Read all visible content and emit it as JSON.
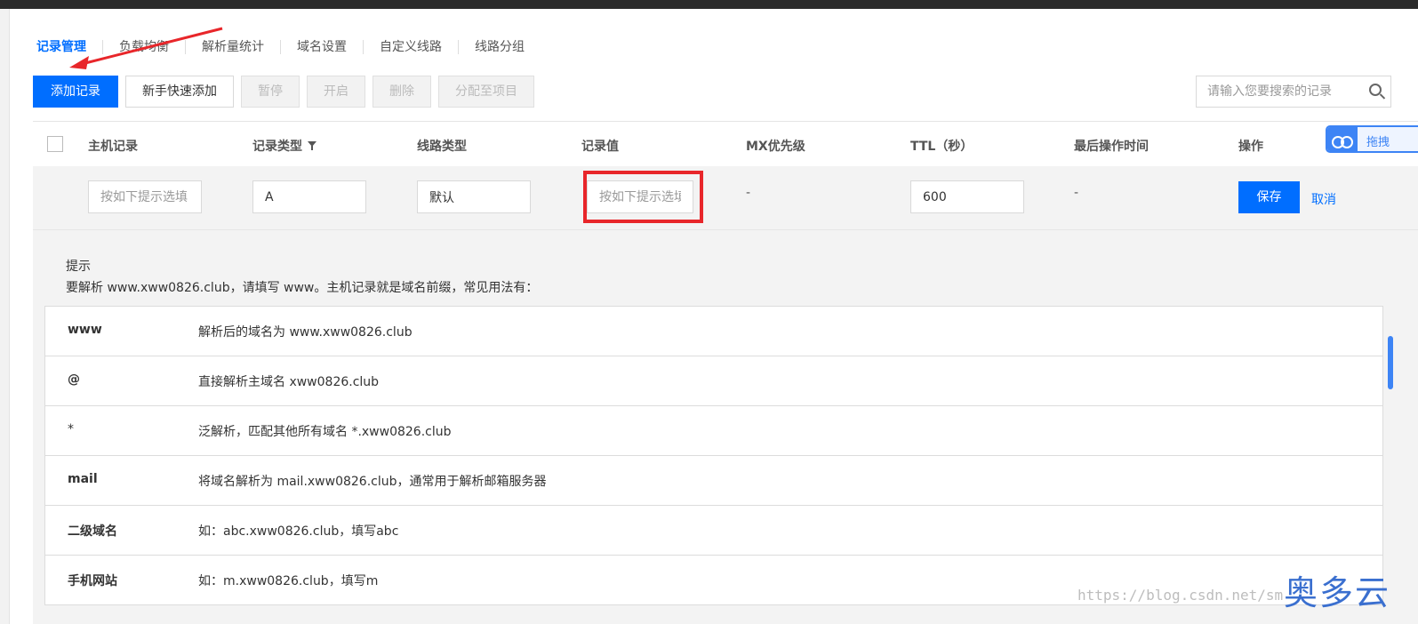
{
  "tabs": [
    "记录管理",
    "负载均衡",
    "解析量统计",
    "域名设置",
    "自定义线路",
    "线路分组"
  ],
  "toolbar": {
    "add_record": "添加记录",
    "quick_add": "新手快速添加",
    "pause": "暂停",
    "enable": "开启",
    "delete": "删除",
    "assign_project": "分配至项目"
  },
  "search": {
    "placeholder": "请输入您要搜索的记录"
  },
  "table": {
    "headers": {
      "host": "主机记录",
      "type": "记录类型",
      "line": "线路类型",
      "value": "记录值",
      "mx": "MX优先级",
      "ttl": "TTL（秒）",
      "last_op": "最后操作时间",
      "action": "操作"
    }
  },
  "edit_row": {
    "host_placeholder": "按如下提示选填",
    "type": "A",
    "line": "默认",
    "value_placeholder": "按如下提示选填",
    "mx": "-",
    "ttl": "600",
    "last_op": "-",
    "save": "保存",
    "cancel": "取消"
  },
  "tip": {
    "title": "提示",
    "desc": "要解析 www.xww0826.club，请填写 www。主机记录就是域名前缀，常见用法有：",
    "rows": [
      {
        "key": "www",
        "val": "解析后的域名为 www.xww0826.club"
      },
      {
        "key": "@",
        "val": "直接解析主域名 xww0826.club"
      },
      {
        "key": "*",
        "val": "泛解析，匹配其他所有域名 *.xww0826.club"
      },
      {
        "key": "mail",
        "val": "将域名解析为 mail.xww0826.club，通常用于解析邮箱服务器"
      },
      {
        "key": "二级域名",
        "val": "如：abc.xww0826.club，填写abc"
      },
      {
        "key": "手机网站",
        "val": "如：m.xww0826.club，填写m"
      }
    ]
  },
  "widget": {
    "text": "拖拽"
  },
  "watermark": "https://blog.csdn.net/sm",
  "brand": "奥多云",
  "colors": {
    "primary": "#006eff",
    "highlight_box": "#e8262a",
    "arrow": "#e8262a"
  }
}
